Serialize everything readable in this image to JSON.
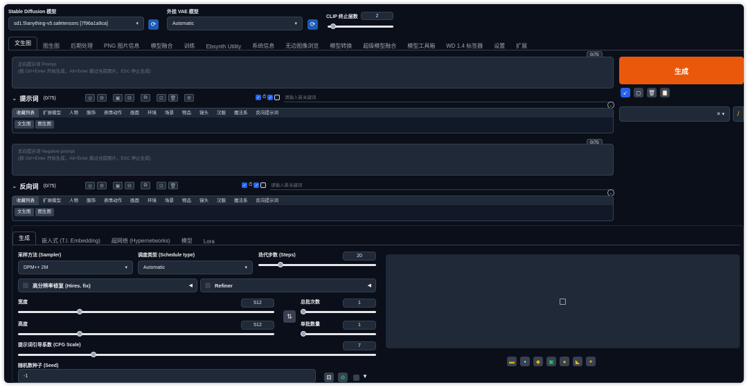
{
  "model": {
    "sd_label": "Stable Diffusion 模型",
    "sd_value": "sd1.5\\anything-v5.safetensors [7f96a1a9ca]",
    "vae_label": "外挂 VAE 模型",
    "vae_value": "Automatic",
    "clip_label": "CLIP 终止层数",
    "clip_value": "2",
    "clip_level": 0.08
  },
  "tabs": [
    "文生图",
    "图生图",
    "后期处理",
    "PNG 图片信息",
    "模型融合",
    "训练",
    "Ebsynth Utility",
    "系统信息",
    "无边图像浏览",
    "模型转换",
    "超级模型融合",
    "模型工具箱",
    "WD 1.4 标签器",
    "设置",
    "扩展"
  ],
  "prompt": {
    "counter": "0/75",
    "placeholder_1": "正向提示词 Prompt",
    "placeholder_2": "(按 Ctrl+Enter 开始生成，Alt+Enter 跳过当前图片，ESC 停止生成)",
    "heading": "提示词",
    "heading_count": "(0/75)",
    "keyword_placeholder": "请输入新关键词"
  },
  "negative": {
    "counter": "0/75",
    "placeholder_1": "反向提示词 Negative prompt",
    "placeholder_2": "(按 Ctrl+Enter 开始生成，Alt+Enter 跳过当前图片，ESC 停止生成)",
    "heading": "反向词",
    "heading_count": "(0/75)",
    "keyword_placeholder": "请输入新关键词"
  },
  "categories": [
    "收藏列表",
    "扩展模型",
    "人物",
    "服饰",
    "表情动作",
    "画面",
    "环境",
    "场景",
    "物品",
    "镜头",
    "汉服",
    "魔法系",
    "反向提示词"
  ],
  "subcategories": [
    "文生图",
    "图生图"
  ],
  "generate_label": "生成",
  "lower_tabs": [
    "生成",
    "嵌入式 (T.I. Embedding)",
    "超网络 (Hypernetworks)",
    "模型",
    "Lora"
  ],
  "params": {
    "sampler_label": "采样方法 (Sampler)",
    "sampler_value": "DPM++ 2M",
    "schedule_label": "调度类型 (Schedule type)",
    "schedule_value": "Automatic",
    "steps_label": "迭代步数 (Steps)",
    "steps_value": "20",
    "steps_level": 0.19,
    "hires_label": "高分辨率修复 (Hires. fix)",
    "refiner_label": "Refiner",
    "width_label": "宽度",
    "width_value": "512",
    "width_level": 0.24,
    "height_label": "高度",
    "height_value": "512",
    "height_level": 0.24,
    "batch_count_label": "总批次数",
    "batch_count_value": "1",
    "batch_size_label": "单批数量",
    "batch_size_value": "1",
    "cfg_label": "提示词引导系数 (CFG Scale)",
    "cfg_value": "7",
    "cfg_level": 0.21,
    "seed_label": "随机数种子 (Seed)",
    "seed_value": "-1"
  }
}
